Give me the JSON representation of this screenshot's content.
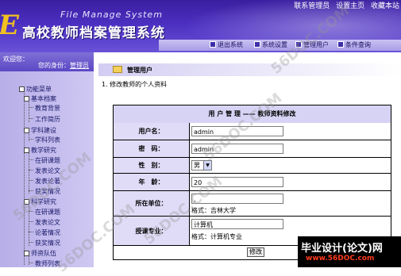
{
  "header": {
    "subtitle": "File Manage System",
    "title": "高校教师档案管理系统",
    "top_links": [
      "联系管理员",
      "设置主页",
      "收藏本站"
    ],
    "nav": [
      "退出系统",
      "系统设置",
      "管理用户",
      "条件查询"
    ]
  },
  "sidebar": {
    "welcome": "欢迎您：",
    "role_label": "您的身份：",
    "role_value": "管理员",
    "tree": [
      {
        "label": "功能菜单",
        "type": "folder"
      },
      {
        "label": "基本档案",
        "type": "folder"
      },
      {
        "label": "教育背景",
        "type": "leaf"
      },
      {
        "label": "工作简历",
        "type": "leaf"
      },
      {
        "label": "学科建设",
        "type": "folder"
      },
      {
        "label": "学科列表",
        "type": "leaf"
      },
      {
        "label": "教学研究",
        "type": "folder"
      },
      {
        "label": "在研课题",
        "type": "leaf"
      },
      {
        "label": "发表论文",
        "type": "leaf"
      },
      {
        "label": "发表论著",
        "type": "leaf"
      },
      {
        "label": "获奖情况",
        "type": "leaf"
      },
      {
        "label": "科学研究",
        "type": "folder"
      },
      {
        "label": "在研课题",
        "type": "leaf"
      },
      {
        "label": "发表论文",
        "type": "leaf"
      },
      {
        "label": "论著情况",
        "type": "leaf"
      },
      {
        "label": "获奖情况",
        "type": "leaf"
      },
      {
        "label": "师资队伍",
        "type": "folder"
      },
      {
        "label": "教师列表",
        "type": "leaf"
      }
    ]
  },
  "main": {
    "section_title": "管理用户",
    "breadcrumb": "1.  修改教师的个人资料",
    "form_title": "用 户 管 理 ——  教师资料修改",
    "username_label": "用户名：",
    "username_value": "admin",
    "password_label": "密　码：",
    "password_value": "admin",
    "gender_label": "性　别：",
    "gender_value": "男",
    "age_label": "年　龄：",
    "age_value": "20",
    "unit_label": "所在单位：",
    "unit_value": ",",
    "unit_hint": "格式：吉林大学",
    "major_label": "授课专业：",
    "major_value": "计算机",
    "major_hint": "格式：计算机专业",
    "submit_label": "修改"
  },
  "watermark": "56DOC.COM",
  "banner": {
    "top": "毕业设计(论文)网",
    "bottom": "www.56DOC.com"
  }
}
